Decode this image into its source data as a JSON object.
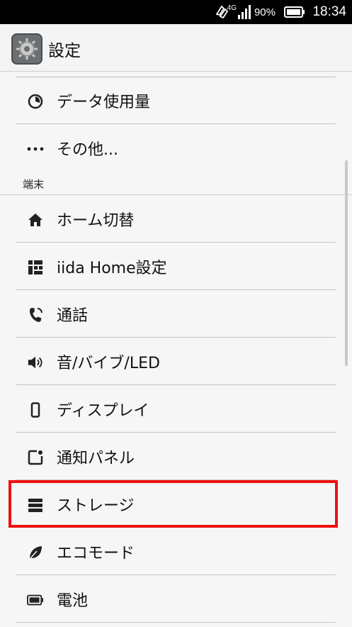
{
  "status_bar": {
    "network": "4G",
    "battery_percent": "90%",
    "time": "18:34"
  },
  "action_bar": {
    "title": "設定",
    "app_icon": "settings-gear-icon"
  },
  "list": {
    "items_top": [
      {
        "label": "データ使用量",
        "icon": "data-usage-icon"
      },
      {
        "label": "その他...",
        "icon": "more-icon"
      }
    ],
    "section_device": "端末",
    "items_device": [
      {
        "label": "ホーム切替",
        "icon": "home-icon"
      },
      {
        "label": "iida Home設定",
        "icon": "grid-icon"
      },
      {
        "label": "通話",
        "icon": "phone-icon"
      },
      {
        "label": "音/バイブ/LED",
        "icon": "volume-icon"
      },
      {
        "label": "ディスプレイ",
        "icon": "display-icon"
      },
      {
        "label": "通知パネル",
        "icon": "notification-icon"
      },
      {
        "label": "ストレージ",
        "icon": "storage-icon"
      },
      {
        "label": "エコモード",
        "icon": "leaf-icon"
      },
      {
        "label": "電池",
        "icon": "battery-icon"
      }
    ]
  },
  "highlight_color": "#ee1111"
}
